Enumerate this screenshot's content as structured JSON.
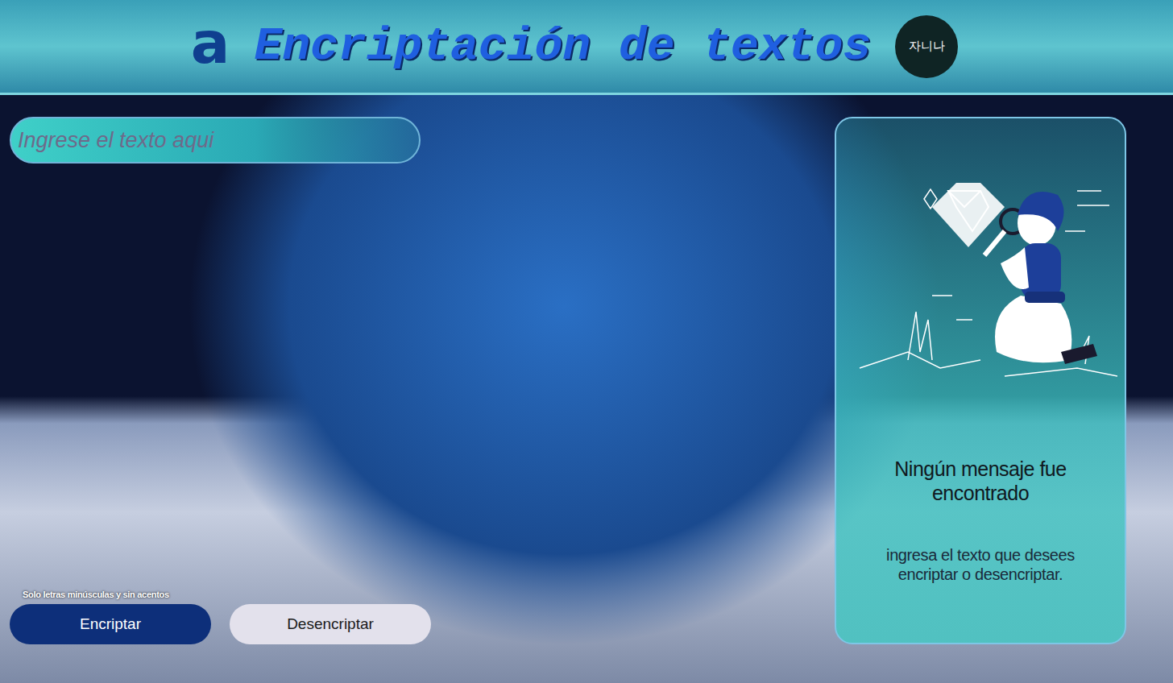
{
  "header": {
    "logo": "a",
    "title": "Encriptación de textos",
    "avatar": "자니나"
  },
  "input": {
    "placeholder": "Ingrese el texto aqui"
  },
  "hint": "Solo letras minúsculas y sin acentos",
  "buttons": [
    {
      "label": "Encriptar",
      "kind": "primary"
    },
    {
      "label": "Desencriptar",
      "kind": "secondary"
    }
  ],
  "result": {
    "title": "Ningún mensaje fue encontrado",
    "message": "ingresa el texto que desees encriptar o desencriptar."
  }
}
